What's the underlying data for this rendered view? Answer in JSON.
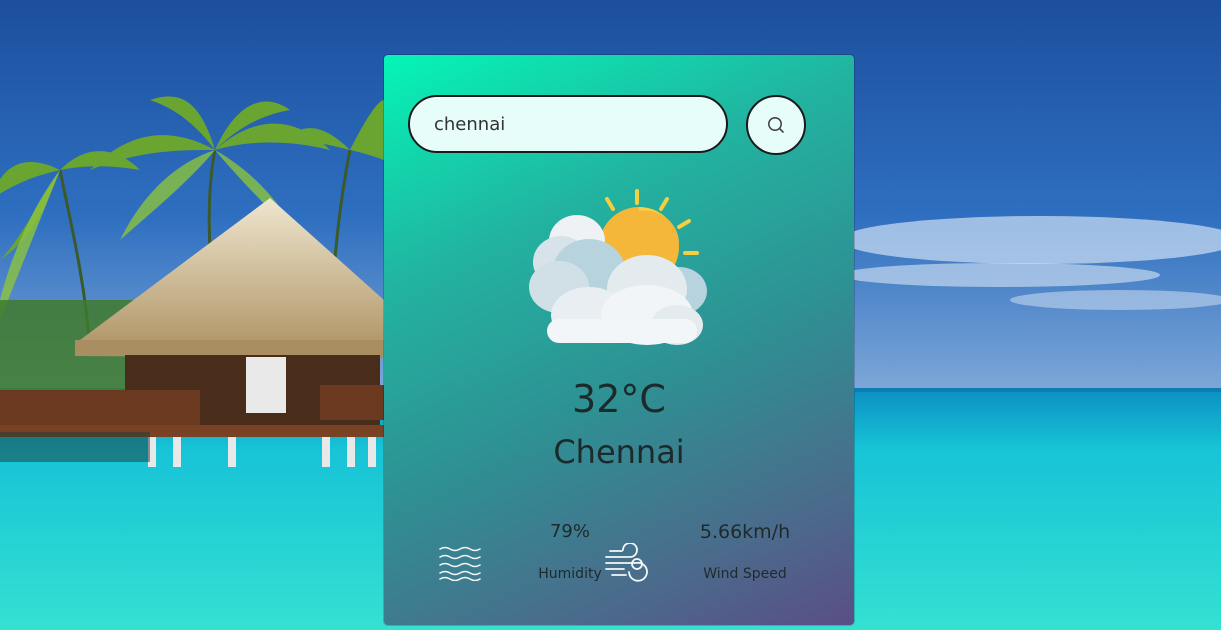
{
  "search": {
    "value": "chennai",
    "button_icon": "search-icon"
  },
  "weather": {
    "icon": "partly-cloudy-sun-icon",
    "temperature": "32°C",
    "city": "Chennai",
    "humidity": {
      "icon": "humidity-waves-icon",
      "value": "79%",
      "label": "Humidity"
    },
    "wind": {
      "icon": "wind-icon",
      "value": "5.66km/h",
      "label": "Wind Speed"
    }
  },
  "theme": {
    "card_gradient_start": "#05f5b7",
    "card_gradient_end": "#5a4e86",
    "input_bg": "#e6fdfa",
    "text_color": "#1d2a2b"
  }
}
